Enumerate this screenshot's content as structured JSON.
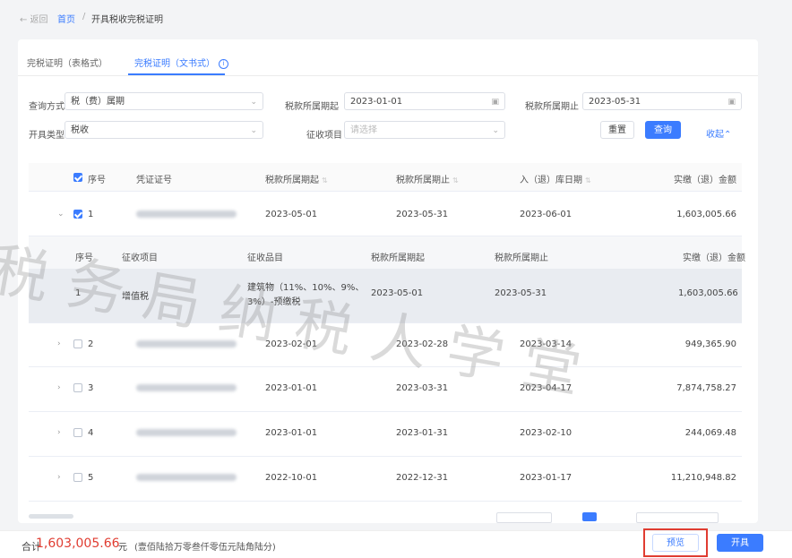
{
  "breadcrumb": {
    "back": "← 返回",
    "home": "首页",
    "separator": "/",
    "current": "开具税收完税证明"
  },
  "tabs": [
    {
      "label": "完税证明（表格式）",
      "active": false
    },
    {
      "label": "完税证明（文书式）",
      "active": true
    }
  ],
  "filters": {
    "query_method_label": "查询方式",
    "query_method_value": "税（费）属期",
    "period_start_label": "税款所属期起",
    "period_start_value": "2023-01-01",
    "period_end_label": "税款所属期止",
    "period_end_value": "2023-05-31",
    "issue_type_label": "开具类型",
    "issue_type_value": "税收",
    "levy_item_label": "征收项目",
    "levy_item_placeholder": "请选择"
  },
  "buttons": {
    "reset": "重置",
    "query": "查询",
    "collapse": "收起",
    "preview": "预览",
    "issue": "开具"
  },
  "table": {
    "headers": [
      "序号",
      "凭证证号",
      "税款所属期起",
      "税款所属期止",
      "入（退）库日期",
      "实缴（退）金额"
    ],
    "rows": [
      {
        "no": "1",
        "start": "2023-05-01",
        "end": "2023-05-31",
        "date": "2023-06-01",
        "amount": "1,603,005.66",
        "checked": true,
        "expanded": true
      },
      {
        "no": "2",
        "start": "2023-02-01",
        "end": "2023-02-28",
        "date": "2023-03-14",
        "amount": "949,365.90",
        "checked": false,
        "expanded": false
      },
      {
        "no": "3",
        "start": "2023-01-01",
        "end": "2023-03-31",
        "date": "2023-04-17",
        "amount": "7,874,758.27",
        "checked": false,
        "expanded": false
      },
      {
        "no": "4",
        "start": "2023-01-01",
        "end": "2023-01-31",
        "date": "2023-02-10",
        "amount": "244,069.48",
        "checked": false,
        "expanded": false
      },
      {
        "no": "5",
        "start": "2022-10-01",
        "end": "2022-12-31",
        "date": "2023-01-17",
        "amount": "11,210,948.82",
        "checked": false,
        "expanded": false
      }
    ]
  },
  "subtable": {
    "headers": [
      "序号",
      "征收项目",
      "征收品目",
      "税款所属期起",
      "税款所属期止",
      "实缴（退）金额"
    ],
    "rows": [
      {
        "no": "1",
        "item": "增值税",
        "category_line1": "建筑物（11%、10%、9%、",
        "category_line2": "3%）-预缴税",
        "start": "2023-05-01",
        "end": "2023-05-31",
        "amount": "1,603,005.66"
      }
    ]
  },
  "watermark": "税务局纳税人学堂",
  "footer": {
    "total_label": "合计",
    "total_amount": "1,603,005.66",
    "unit": "元",
    "note": "(壹佰陆拾万零叁仟零伍元陆角陆分)"
  },
  "colors": {
    "primary": "#3b7cff",
    "danger": "#e03c31"
  }
}
